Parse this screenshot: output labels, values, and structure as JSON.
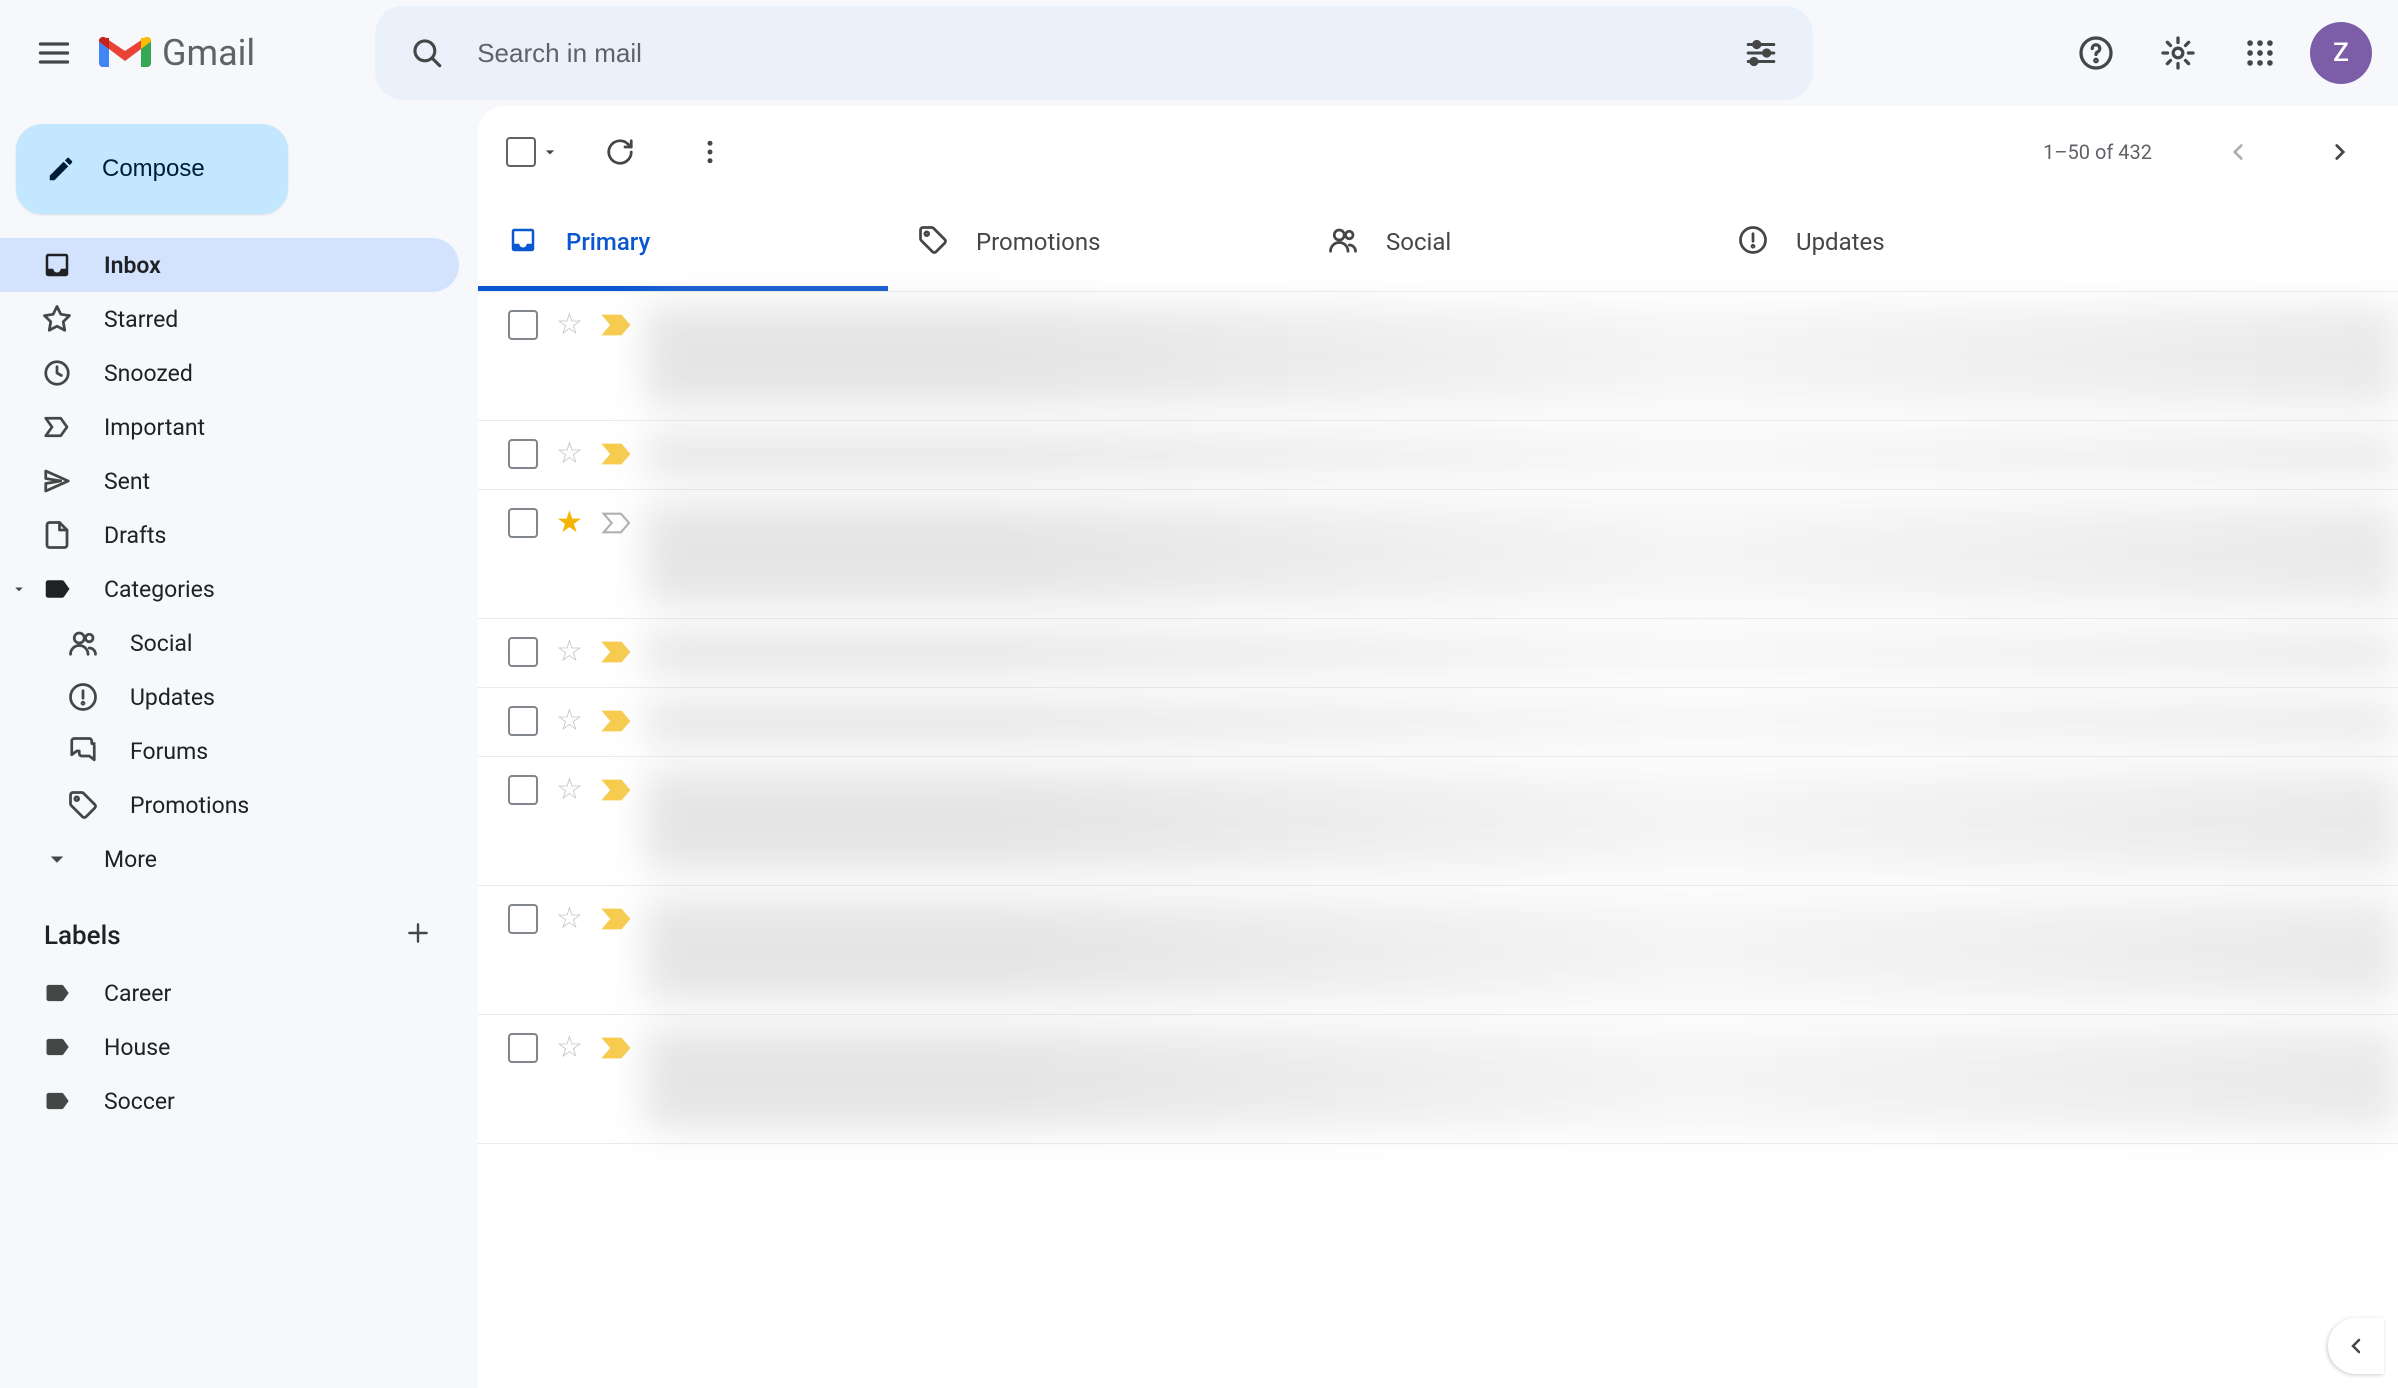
{
  "header": {
    "product_name": "Gmail",
    "search_placeholder": "Search in mail",
    "avatar_initial": "Z"
  },
  "compose_label": "Compose",
  "nav": {
    "inbox": "Inbox",
    "starred": "Starred",
    "snoozed": "Snoozed",
    "important": "Important",
    "sent": "Sent",
    "drafts": "Drafts",
    "categories": "Categories",
    "sub_social": "Social",
    "sub_updates": "Updates",
    "sub_forums": "Forums",
    "sub_promotions": "Promotions",
    "more": "More"
  },
  "labels_header": "Labels",
  "labels": {
    "items": [
      "Career",
      "House",
      "Soccer"
    ]
  },
  "toolbar": {
    "page_range": "1–50",
    "page_of": "of",
    "page_total": "432"
  },
  "category_tabs": {
    "primary": "Primary",
    "promotions": "Promotions",
    "social": "Social",
    "updates": "Updates"
  },
  "mail_rows": [
    {
      "starred": false,
      "important": true,
      "height": "tall"
    },
    {
      "starred": false,
      "important": true,
      "height": "short"
    },
    {
      "starred": true,
      "important": false,
      "height": "tall"
    },
    {
      "starred": false,
      "important": true,
      "height": "short"
    },
    {
      "starred": false,
      "important": true,
      "height": "short"
    },
    {
      "starred": false,
      "important": true,
      "height": "tall"
    },
    {
      "starred": false,
      "important": true,
      "height": "tall"
    },
    {
      "starred": false,
      "important": true,
      "height": "tall"
    }
  ],
  "colors": {
    "accent": "#0b57d0",
    "compose_bg": "#c2e7ff",
    "active_nav_bg": "#d3e3fd",
    "search_bg": "#eaf1fb",
    "page_bg": "#f6f8fc",
    "star_on": "#f4b400",
    "important_marker": "#f7cb4d"
  }
}
